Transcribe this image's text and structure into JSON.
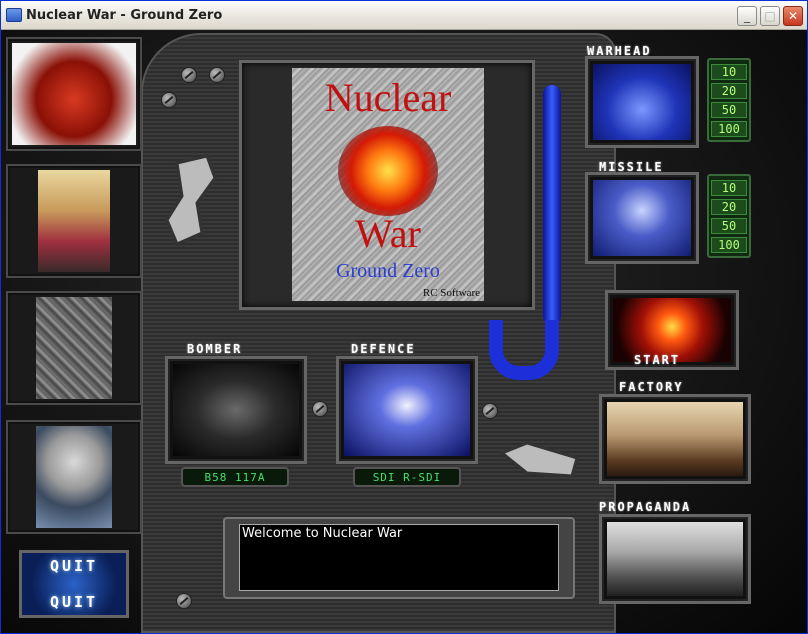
{
  "window": {
    "title": "Nuclear War - Ground Zero",
    "minimize": "_",
    "maximize": "□",
    "close": "✕"
  },
  "cover": {
    "title_line1": "Nuclear",
    "title_line2": "War",
    "subtitle": "Ground Zero",
    "publisher": "RC Software"
  },
  "sections": {
    "warhead": "WARHEAD",
    "missile": "MISSILE",
    "bomber": "BOMBER",
    "defence": "DEFENCE",
    "factory": "FACTORY",
    "propaganda": "PROPAGANDA",
    "start": "START"
  },
  "warhead_quantities": [
    "10",
    "20",
    "50",
    "100"
  ],
  "missile_quantities": [
    "10",
    "20",
    "50",
    "100"
  ],
  "bomber_readout": "B58 117A",
  "defence_readout": "SDI R-SDI",
  "message": "Welcome to Nuclear War",
  "quit": {
    "top": "QUIT",
    "bottom": "QUIT"
  },
  "icons": {
    "portrait1": "demon-leader-portrait",
    "portrait2": "arab-leader-portrait",
    "portrait3": "rubble-portrait",
    "portrait4": "stalin-portrait"
  },
  "colors": {
    "accent_green": "#3fe06a",
    "cable_blue": "#1c2fd8",
    "title_red": "#c01010"
  }
}
